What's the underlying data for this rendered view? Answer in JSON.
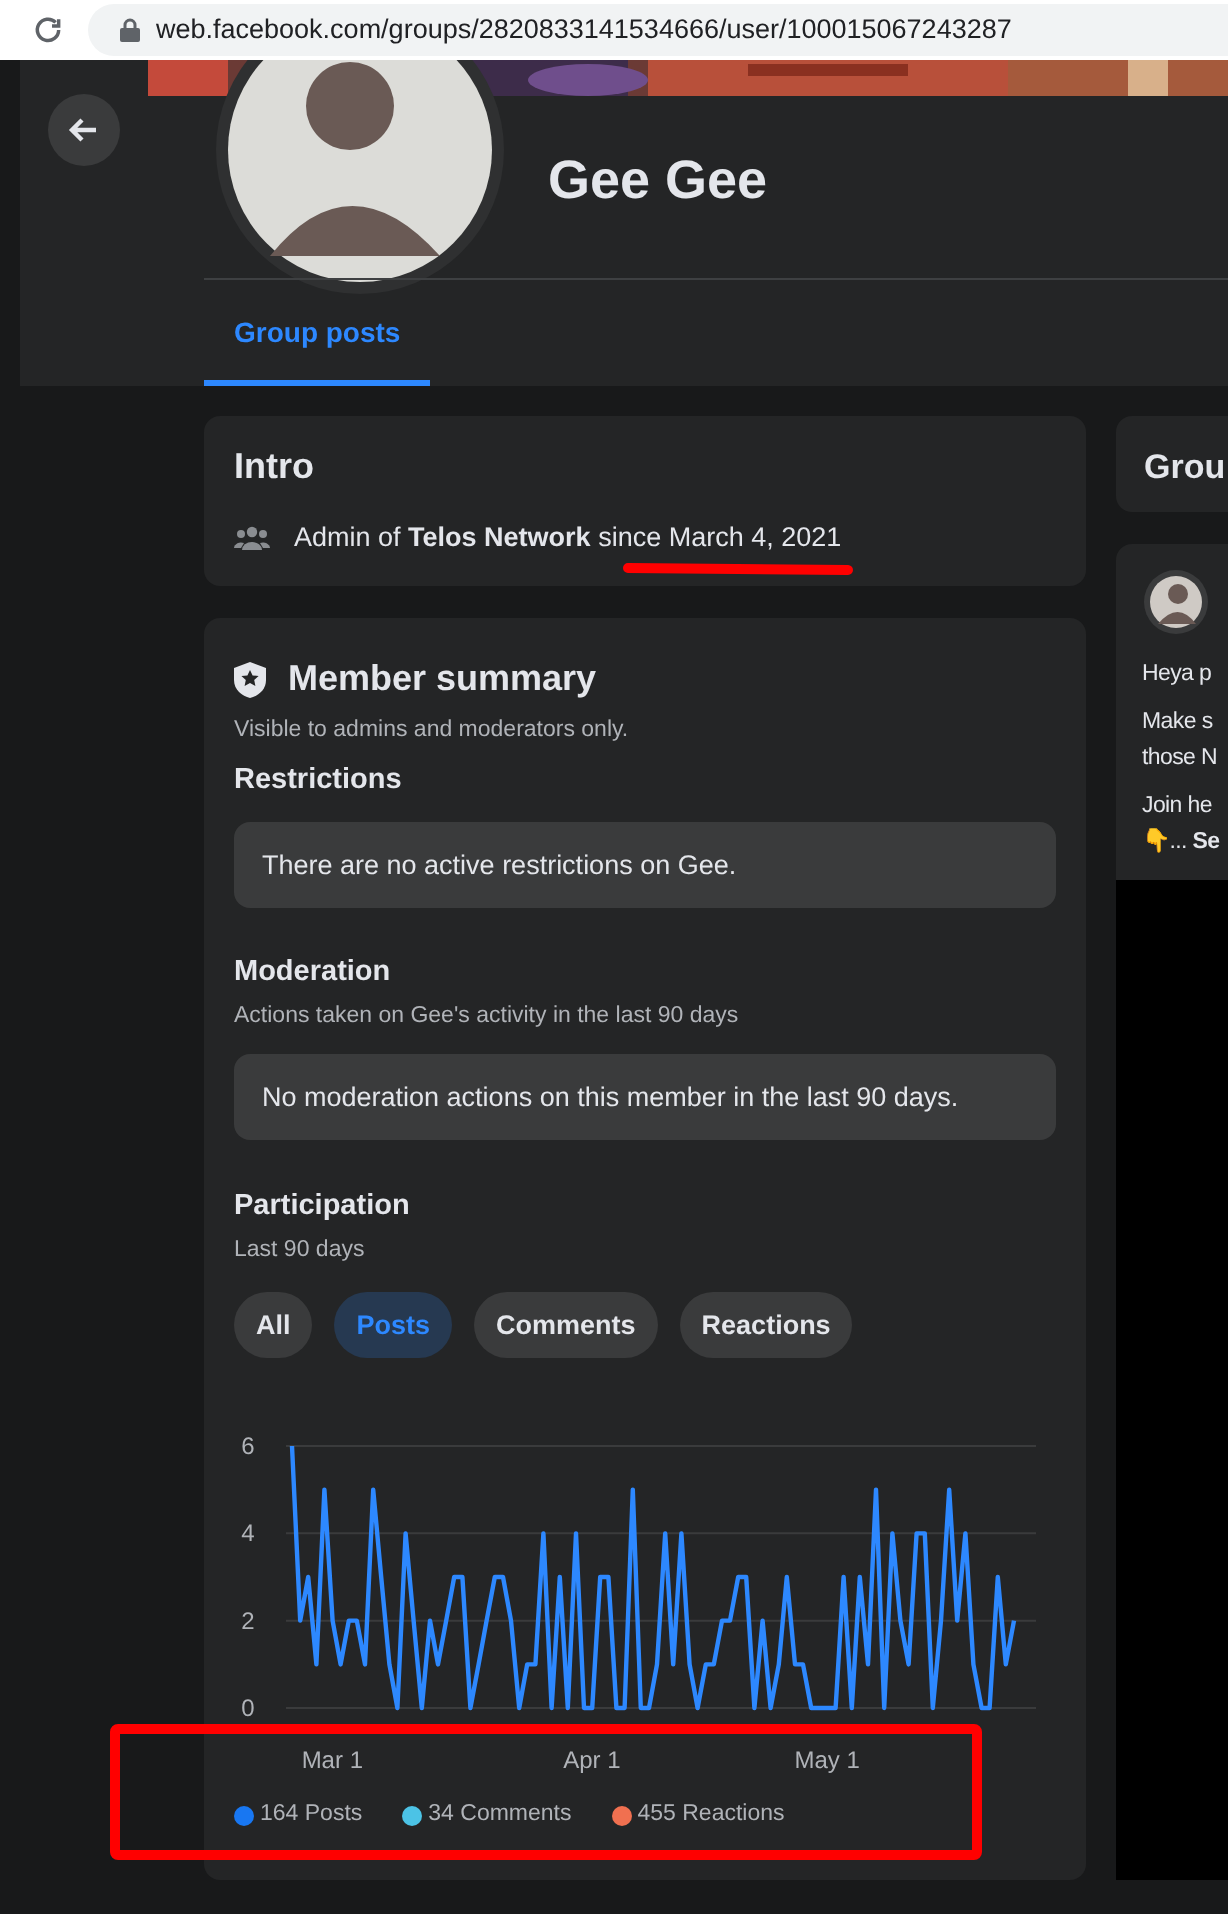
{
  "browser": {
    "url": "web.facebook.com/groups/2820833141534666/user/100015067243287"
  },
  "profile": {
    "name": "Gee Gee"
  },
  "tabs": [
    {
      "label": "Group posts",
      "selected": true
    }
  ],
  "intro": {
    "title": "Intro",
    "line": "Admin of **Telos Network** since March 4, 2021"
  },
  "member_summary": {
    "title": "Member summary",
    "subtitle": "Visible to admins and moderators only.",
    "restrictions": {
      "title": "Restrictions",
      "message": "There are no active restrictions on Gee."
    },
    "moderation": {
      "title": "Moderation",
      "subtitle": "Actions taken on Gee's activity in the last 90 days",
      "message": "No moderation actions on this member in the last 90 days."
    },
    "participation": {
      "title": "Participation",
      "subtitle": "Last 90 days",
      "filters": [
        {
          "label": "All",
          "selected": false
        },
        {
          "label": "Posts",
          "selected": true
        },
        {
          "label": "Comments",
          "selected": false
        },
        {
          "label": "Reactions",
          "selected": false
        }
      ],
      "axis_dates": [
        "Mar 1",
        "Apr 1",
        "May 1"
      ],
      "chart_data": {
        "type": "line",
        "ylim": [
          0,
          6
        ],
        "yticks": [
          0,
          2,
          4,
          6
        ],
        "series": [
          {
            "color": "#2d88ff",
            "values": [
              6,
              2,
              3,
              1,
              5,
              2,
              1,
              2,
              2,
              1,
              5,
              3,
              1,
              0,
              4,
              2,
              0,
              2,
              1,
              2,
              3,
              3,
              0,
              1,
              2,
              3,
              3,
              2,
              0,
              1,
              1,
              4,
              0,
              3,
              0,
              4,
              0,
              0,
              3,
              3,
              0,
              0,
              5,
              0,
              0,
              1,
              4,
              1,
              4,
              1,
              0,
              1,
              1,
              2,
              2,
              3,
              3,
              0,
              2,
              0,
              1,
              3,
              1,
              1,
              0,
              0,
              0,
              0,
              3,
              0,
              3,
              1,
              5,
              0,
              4,
              2,
              1,
              4,
              4,
              0,
              2,
              5,
              2,
              4,
              1,
              0,
              0,
              3,
              1,
              2
            ]
          }
        ]
      },
      "legend": [
        {
          "label": "164 Posts",
          "color": "#1877f2"
        },
        {
          "label": "34 Comments",
          "color": "#4cc3e6"
        },
        {
          "label": "455 Reactions",
          "color": "#f07050"
        }
      ]
    }
  },
  "side": {
    "title": "Grou",
    "post": {
      "lines": [
        "Heya p",
        "Make s",
        "those N",
        "Join he",
        "👇... **Se**"
      ]
    }
  }
}
